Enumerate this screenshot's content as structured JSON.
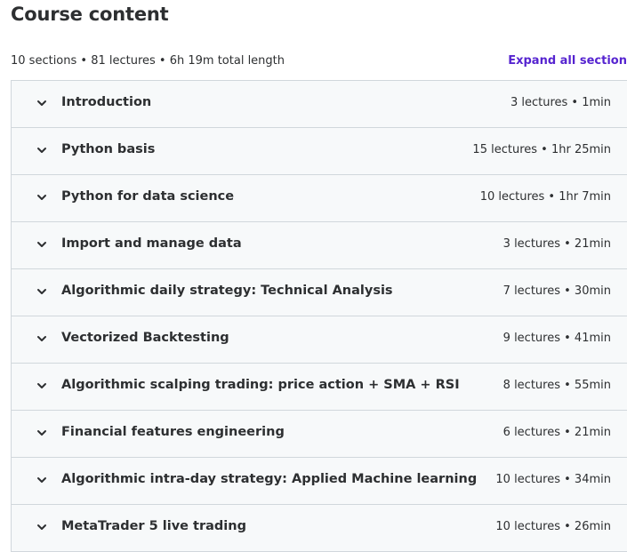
{
  "header": {
    "title": "Course content",
    "meta": "10 sections • 81 lectures • 6h 19m total length",
    "expand_label": "Expand all section"
  },
  "colors": {
    "accent": "#5624d0",
    "row_background": "#f7f9fa",
    "border": "#d1d7dc",
    "text": "#2d2f31"
  },
  "sections": [
    {
      "title": "Introduction",
      "info": "3 lectures • 1min",
      "icon": "chevron-down-icon"
    },
    {
      "title": "Python basis",
      "info": "15 lectures • 1hr 25min",
      "icon": "chevron-down-icon"
    },
    {
      "title": "Python for data science",
      "info": "10 lectures • 1hr 7min",
      "icon": "chevron-down-icon"
    },
    {
      "title": "Import and manage data",
      "info": "3 lectures • 21min",
      "icon": "chevron-down-icon"
    },
    {
      "title": "Algorithmic daily strategy: Technical Analysis",
      "info": "7 lectures • 30min",
      "icon": "chevron-down-icon"
    },
    {
      "title": "Vectorized Backtesting",
      "info": "9 lectures • 41min",
      "icon": "chevron-down-icon"
    },
    {
      "title": "Algorithmic scalping trading: price action + SMA + RSI",
      "info": "8 lectures • 55min",
      "icon": "chevron-down-icon"
    },
    {
      "title": "Financial features engineering",
      "info": "6 lectures • 21min",
      "icon": "chevron-down-icon"
    },
    {
      "title": "Algorithmic intra-day strategy: Applied Machine learning",
      "info": "10 lectures • 34min",
      "icon": "chevron-down-icon"
    },
    {
      "title": "MetaTrader 5 live trading",
      "info": "10 lectures • 26min",
      "icon": "chevron-down-icon"
    }
  ]
}
